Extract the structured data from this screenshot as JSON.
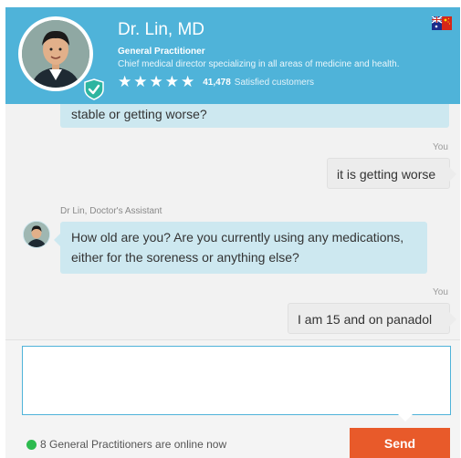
{
  "header": {
    "name": "Dr. Lin, MD",
    "title": "General Practitioner",
    "description": "Chief medical director specializing in all areas of medicine and health.",
    "stars": "★★★★★",
    "rating_count": "41,478",
    "rating_text": "Satisfied customers"
  },
  "chat": {
    "messages": [
      {
        "from": "doctor",
        "text": "stable or getting worse?"
      },
      {
        "from": "user",
        "sender": "You",
        "text": "it is getting worse"
      },
      {
        "from": "doctor",
        "sender": "Dr Lin, Doctor's Assistant",
        "line1": "How old are you? Are you currently using any medications,",
        "line2": "either for the soreness or anything else?"
      },
      {
        "from": "user",
        "sender": "You",
        "text": "I am 15 and on panadol"
      }
    ]
  },
  "composer": {
    "placeholder": "",
    "online_text": "8 General Practitioners are online now",
    "send_label": "Send"
  },
  "colors": {
    "header": "#4fb3d9",
    "bot_bubble": "#cde8f0",
    "user_bubble": "#ececec",
    "send": "#e85a2a",
    "online": "#2dbb4f"
  },
  "icons": [
    "doctor-avatar",
    "verified-shield-icon",
    "star-icon",
    "australia-flag-icon",
    "china-flag-icon",
    "online-dot-icon"
  ]
}
